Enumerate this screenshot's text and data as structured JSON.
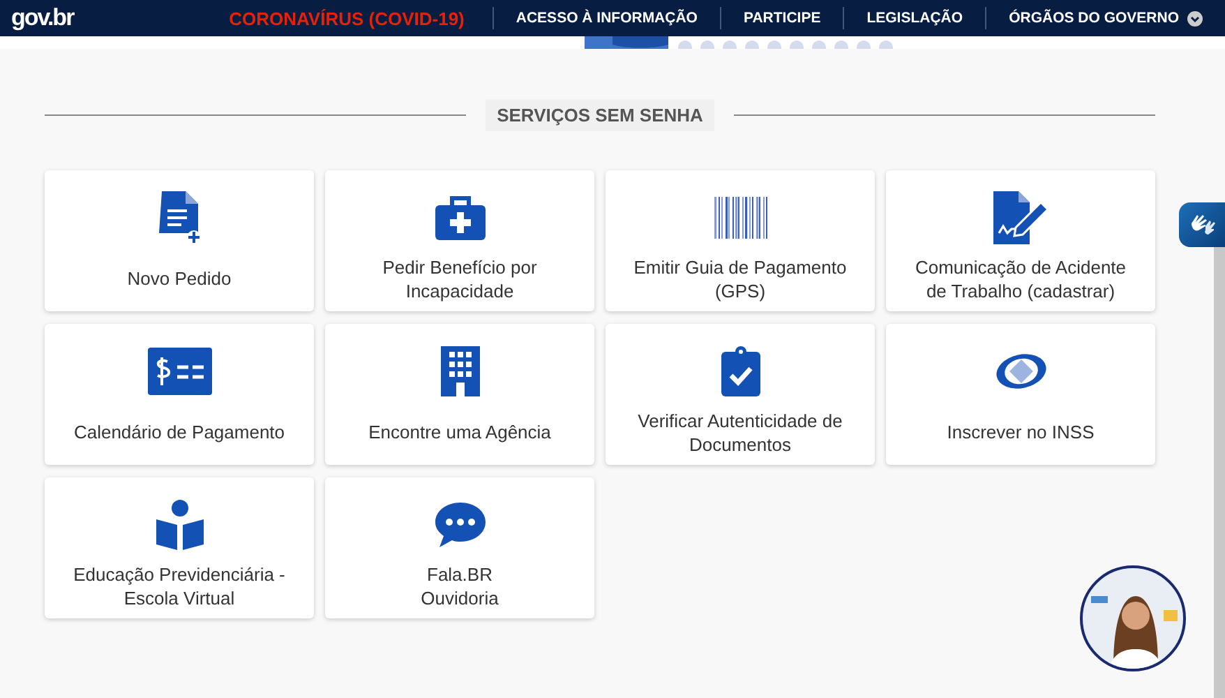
{
  "header": {
    "logo": "gov.br",
    "links": [
      {
        "label": "CORONAVÍRUS (COVID-19)",
        "kind": "alert"
      },
      {
        "label": "ACESSO À INFORMAÇÃO",
        "kind": "link"
      },
      {
        "label": "PARTICIPE",
        "kind": "link"
      },
      {
        "label": "LEGISLAÇÃO",
        "kind": "link"
      },
      {
        "label": "ÓRGÃOS DO GOVERNO",
        "kind": "menu"
      }
    ]
  },
  "section": {
    "title": "SERVIÇOS SEM SENHA",
    "services": [
      {
        "label": "Novo Pedido"
      },
      {
        "label": "Pedir Benefício por Incapacidade"
      },
      {
        "label": "Emitir Guia de Pagamento (GPS)"
      },
      {
        "label": "Comunicação de Acidente de Trabalho (cadastrar)"
      },
      {
        "label": "Calendário de Pagamento"
      },
      {
        "label": "Encontre uma Agência"
      },
      {
        "label": "Verificar Autenticidade de Documentos"
      },
      {
        "label": "Inscrever no INSS"
      },
      {
        "label": "Educação Previdenciária - Escola Virtual"
      },
      {
        "label": "Fala.BR\nOuvidoria"
      }
    ]
  }
}
